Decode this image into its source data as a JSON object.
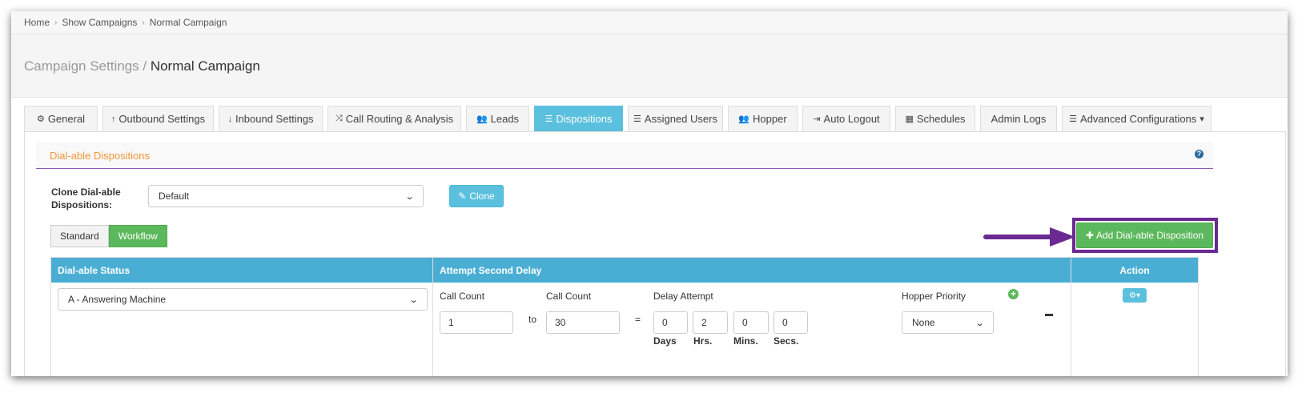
{
  "breadcrumb": [
    "Home",
    "Show Campaigns",
    "Normal Campaign"
  ],
  "page_title": {
    "section": "Campaign Settings /",
    "name": "Normal Campaign"
  },
  "tabs": [
    {
      "label": "General",
      "icon": "cogs-icon"
    },
    {
      "label": "Outbound Settings",
      "icon": "arrow-up-icon"
    },
    {
      "label": "Inbound Settings",
      "icon": "arrow-down-icon"
    },
    {
      "label": "Call Routing & Analysis",
      "icon": "shuffle-icon"
    },
    {
      "label": "Leads",
      "icon": "users-icon"
    },
    {
      "label": "Dispositions",
      "icon": "list-icon",
      "active": true
    },
    {
      "label": "Assigned Users",
      "icon": "list-icon"
    },
    {
      "label": "Hopper",
      "icon": "users-icon"
    },
    {
      "label": "Auto Logout",
      "icon": "sign-out-icon"
    },
    {
      "label": "Schedules",
      "icon": "calendar-icon"
    },
    {
      "label": "Admin Logs",
      "icon": ""
    },
    {
      "label": "Advanced Configurations",
      "icon": "list-alt-icon",
      "dropdown": true
    }
  ],
  "section": {
    "title": "Dial-able Dispositions",
    "help": "?"
  },
  "clone": {
    "label": "Clone Dial-able Dispositions:",
    "selected": "Default",
    "button": "Clone"
  },
  "mode_toggle": {
    "standard": "Standard",
    "workflow": "Workflow",
    "active": "Workflow"
  },
  "add_button": "Add Dial-able Disposition",
  "table": {
    "headers": {
      "status": "Dial-able Status",
      "delay": "Attempt Second Delay",
      "action": "Action"
    },
    "row": {
      "status": "A - Answering Machine",
      "call_count_label_1": "Call Count",
      "call_count_label_2": "Call Count",
      "delay_attempt_label": "Delay Attempt",
      "hopper_priority_label": "Hopper Priority",
      "call_count_from": "1",
      "to": "to",
      "call_count_to": "30",
      "equals": "=",
      "days": "0",
      "hrs": "2",
      "mins": "0",
      "secs": "0",
      "days_label": "Days",
      "hrs_label": "Hrs.",
      "mins_label": "Mins.",
      "secs_label": "Secs.",
      "hopper_priority": "None"
    }
  },
  "colors": {
    "accent_info": "#5bc0de",
    "success": "#5cb85c",
    "highlight": "#6a2a92",
    "section_title": "#f0953a"
  }
}
